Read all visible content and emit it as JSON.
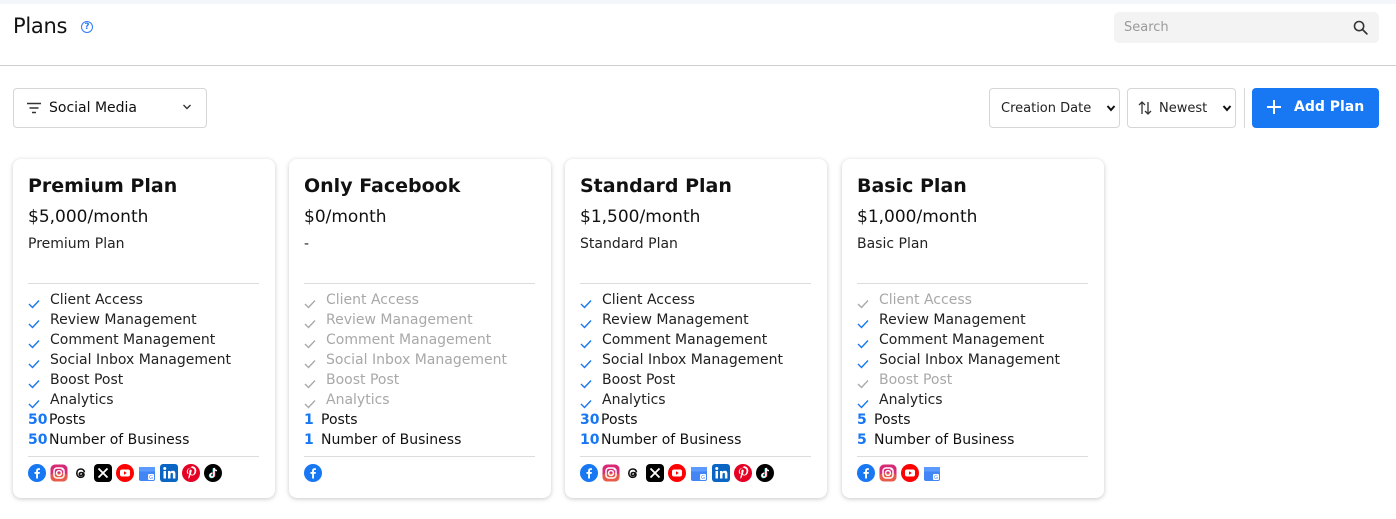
{
  "header": {
    "title": "Plans",
    "search_placeholder": "Search"
  },
  "toolbar": {
    "filter_label": "Social Media",
    "sort_by": "Creation Date",
    "order": "Newest",
    "add_label": "Add Plan"
  },
  "colors": {
    "accent": "#1877f2",
    "check_on": "#1877f2",
    "check_off": "#aaaaaa"
  },
  "feature_labels": [
    "Client Access",
    "Review Management",
    "Comment Management",
    "Social Inbox Management",
    "Boost Post",
    "Analytics"
  ],
  "plans": [
    {
      "name": "Premium Plan",
      "price": "$5,000/month",
      "description": "Premium Plan",
      "features": [
        {
          "label": "Client Access",
          "enabled": true
        },
        {
          "label": "Review Management",
          "enabled": true
        },
        {
          "label": "Comment Management",
          "enabled": true
        },
        {
          "label": "Social Inbox Management",
          "enabled": true
        },
        {
          "label": "Boost Post",
          "enabled": true
        },
        {
          "label": "Analytics",
          "enabled": true
        }
      ],
      "posts": "50",
      "posts_label": "Posts",
      "businesses": "50",
      "businesses_label": "Number of Business",
      "networks": [
        "facebook",
        "instagram",
        "threads",
        "x",
        "youtube",
        "google-business",
        "linkedin",
        "pinterest",
        "tiktok"
      ]
    },
    {
      "name": "Only Facebook",
      "price": "$0/month",
      "description": "-",
      "features": [
        {
          "label": "Client Access",
          "enabled": false
        },
        {
          "label": "Review Management",
          "enabled": false
        },
        {
          "label": "Comment Management",
          "enabled": false
        },
        {
          "label": "Social Inbox Management",
          "enabled": false
        },
        {
          "label": "Boost Post",
          "enabled": false
        },
        {
          "label": "Analytics",
          "enabled": false
        }
      ],
      "posts": "1",
      "posts_label": "Posts",
      "businesses": "1",
      "businesses_label": "Number of Business",
      "networks": [
        "facebook"
      ]
    },
    {
      "name": "Standard Plan",
      "price": "$1,500/month",
      "description": "Standard Plan",
      "features": [
        {
          "label": "Client Access",
          "enabled": true
        },
        {
          "label": "Review Management",
          "enabled": true
        },
        {
          "label": "Comment Management",
          "enabled": true
        },
        {
          "label": "Social Inbox Management",
          "enabled": true
        },
        {
          "label": "Boost Post",
          "enabled": true
        },
        {
          "label": "Analytics",
          "enabled": true
        }
      ],
      "posts": "30",
      "posts_label": "Posts",
      "businesses": "10",
      "businesses_label": "Number of Business",
      "networks": [
        "facebook",
        "instagram",
        "threads",
        "x",
        "youtube",
        "google-business",
        "linkedin",
        "pinterest",
        "tiktok"
      ]
    },
    {
      "name": "Basic Plan",
      "price": "$1,000/month",
      "description": "Basic Plan",
      "features": [
        {
          "label": "Client Access",
          "enabled": false
        },
        {
          "label": "Review Management",
          "enabled": true
        },
        {
          "label": "Comment Management",
          "enabled": true
        },
        {
          "label": "Social Inbox Management",
          "enabled": true
        },
        {
          "label": "Boost Post",
          "enabled": false
        },
        {
          "label": "Analytics",
          "enabled": true
        }
      ],
      "posts": "5",
      "posts_label": "Posts",
      "businesses": "5",
      "businesses_label": "Number of Business",
      "networks": [
        "facebook",
        "instagram",
        "youtube",
        "google-business"
      ]
    }
  ]
}
